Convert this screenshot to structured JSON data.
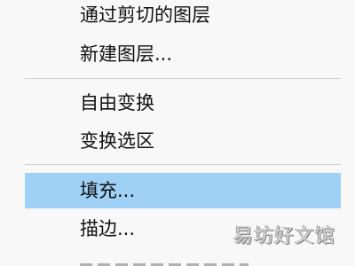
{
  "menu": {
    "items": [
      {
        "label": "通过剪切的图层"
      },
      {
        "label": "新建图层..."
      },
      {
        "label": "自由变换"
      },
      {
        "label": "变换选区"
      },
      {
        "label": "填充..."
      },
      {
        "label": "描边..."
      }
    ],
    "highlight_color": "#9fd0f5"
  },
  "watermark": {
    "text": "易坊好文馆"
  }
}
